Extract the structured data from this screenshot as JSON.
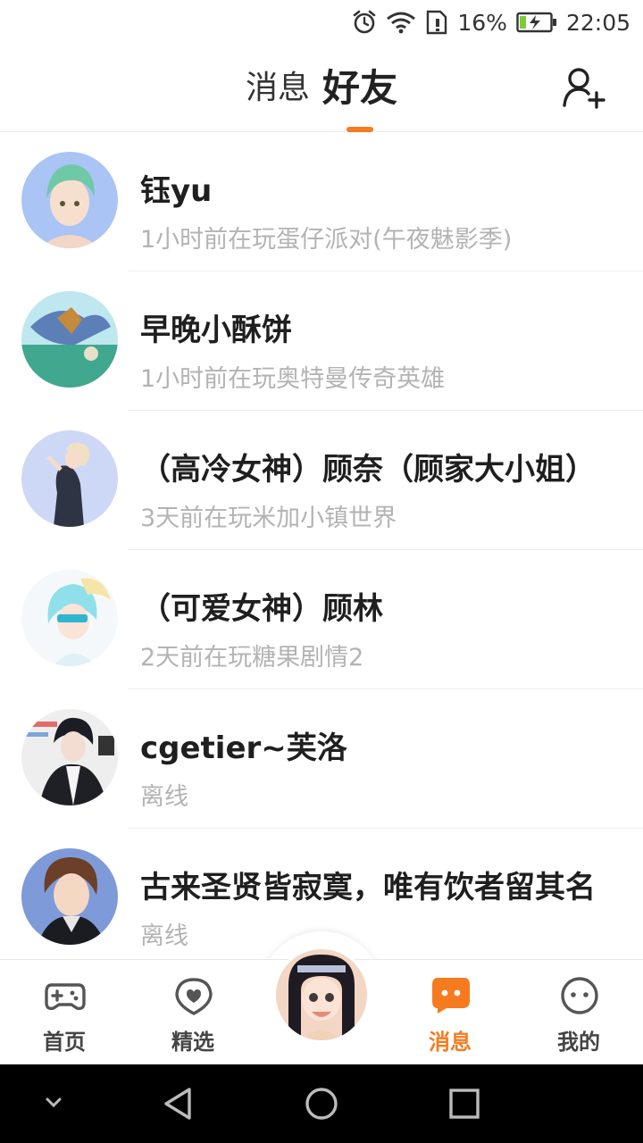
{
  "status_bar": {
    "battery_percent": "16%",
    "time": "22:05",
    "icons": [
      "alarm-icon",
      "wifi-icon",
      "sim-icon",
      "battery-charging-icon"
    ]
  },
  "header": {
    "tabs": [
      {
        "label": "消息",
        "active": false
      },
      {
        "label": "好友",
        "active": true
      }
    ],
    "add_friend_icon": "add-user-icon",
    "accent_color": "#f67b1f"
  },
  "friends": [
    {
      "name": "钰yu",
      "status": "1小时前在玩蛋仔派对(午夜魅影季)"
    },
    {
      "name": "早晚小酥饼",
      "status": "1小时前在玩奥特曼传奇英雄"
    },
    {
      "name": "（高冷女神）顾奈（顾家大小姐）",
      "status": "3天前在玩米加小镇世界"
    },
    {
      "name": "（可爱女神）顾林",
      "status": "2天前在玩糖果剧情2"
    },
    {
      "name": "cgetier~芙洛",
      "status": "离线"
    },
    {
      "name": "古来圣贤皆寂寞，唯有饮者留其名",
      "status": "离线"
    }
  ],
  "bottom_nav": {
    "items": [
      {
        "label": "首页",
        "icon": "gamepad-icon",
        "active": false
      },
      {
        "label": "精选",
        "icon": "heart-badge-icon",
        "active": false
      },
      {
        "label": "消息",
        "icon": "message-icon",
        "active": true
      },
      {
        "label": "我的",
        "icon": "face-icon",
        "active": false
      }
    ],
    "center_icon": "avatar"
  },
  "system_nav": {
    "icons": [
      "chevron-down-icon",
      "back-icon",
      "home-icon",
      "recents-icon"
    ]
  }
}
